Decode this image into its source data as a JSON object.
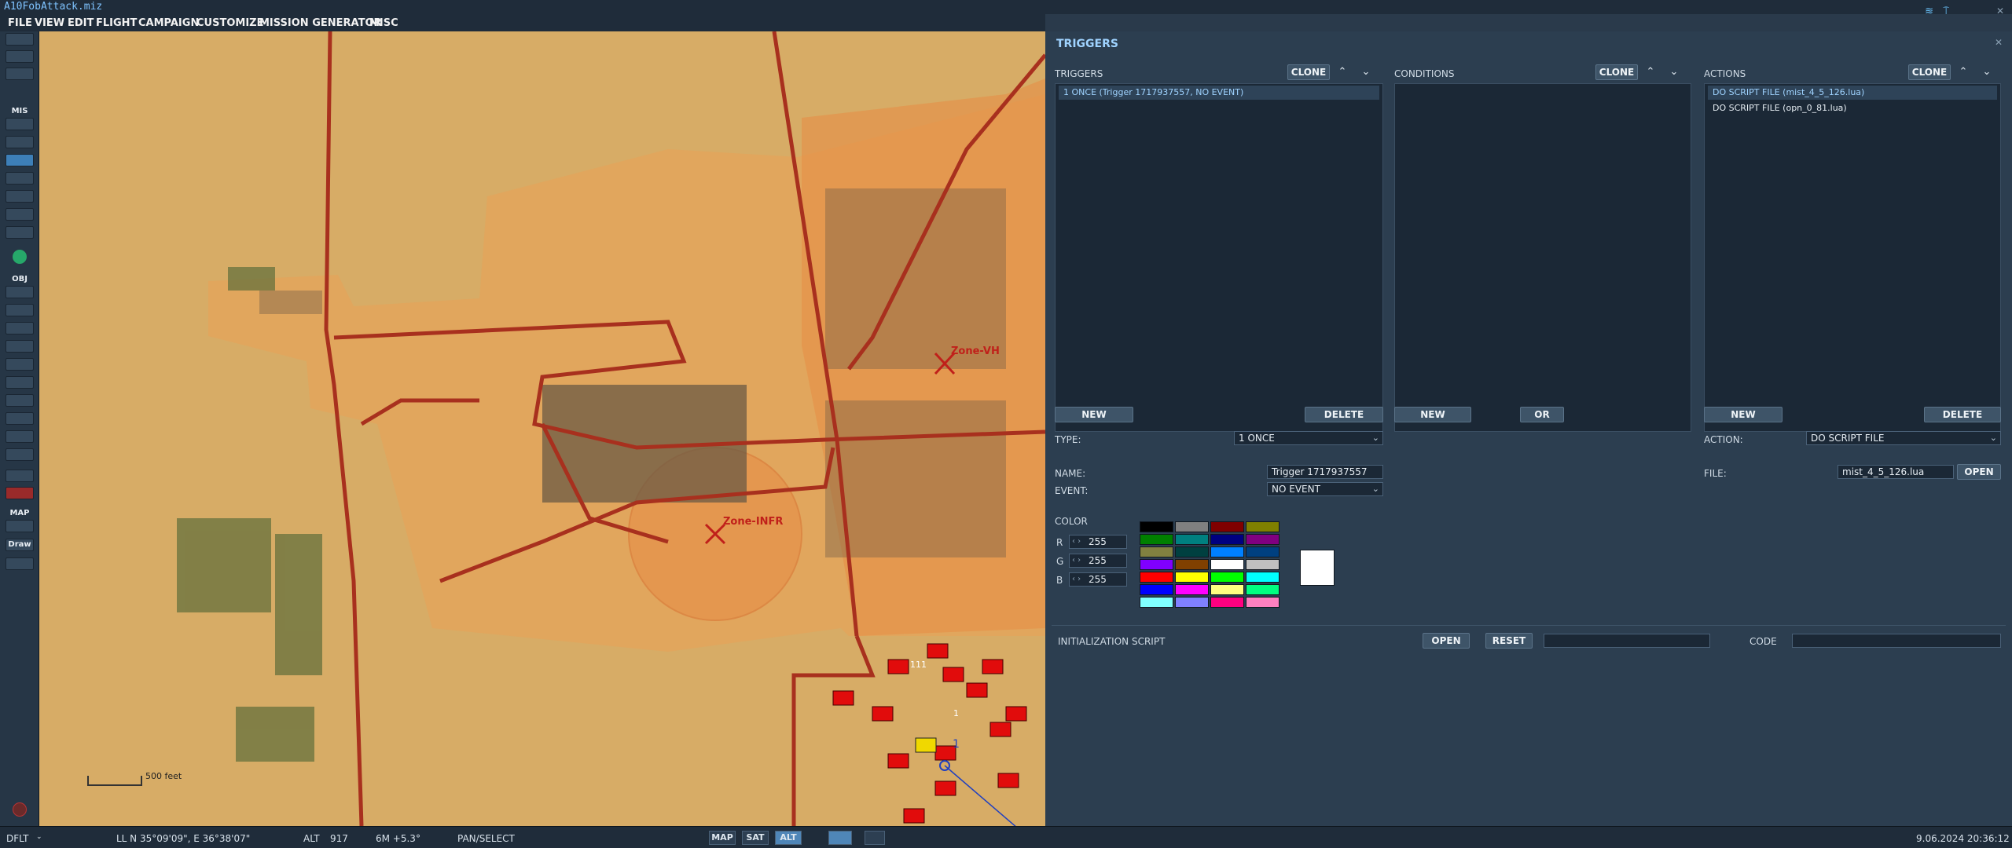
{
  "title": "A10FobAttack.miz",
  "menu": [
    "FILE",
    "VIEW",
    "EDIT",
    "FLIGHT",
    "CAMPAIGN",
    "CUSTOMIZE",
    "MISSION GENERATOR",
    "MISC"
  ],
  "toolbar": {
    "mis_label": "MIS",
    "obj_label": "OBJ",
    "map_label": "MAP",
    "draw_label": "Draw"
  },
  "map": {
    "zones": [
      "Zone-VH",
      "Zone-INFR"
    ],
    "scale_label": "500 feet",
    "unit_marks": [
      "1",
      "111",
      "1",
      "1",
      "1",
      "1",
      "1",
      "1",
      "1",
      "1",
      "1",
      "1"
    ]
  },
  "panel": {
    "title": "TRIGGERS",
    "triggers": {
      "label": "TRIGGERS",
      "clone": "CLONE",
      "items": [
        "1 ONCE (Trigger 1717937557, NO EVENT)"
      ],
      "new": "NEW",
      "delete": "DELETE"
    },
    "conditions": {
      "label": "CONDITIONS",
      "clone": "CLONE",
      "new": "NEW",
      "or": "OR"
    },
    "actions": {
      "label": "ACTIONS",
      "clone": "CLONE",
      "items": [
        "DO SCRIPT FILE (mist_4_5_126.lua)",
        "DO SCRIPT FILE (opn_0_81.lua)"
      ],
      "new": "NEW",
      "delete": "DELETE"
    },
    "type": {
      "label": "TYPE:",
      "value": "1 ONCE"
    },
    "name": {
      "label": "NAME:",
      "value": "Trigger 1717937557"
    },
    "event": {
      "label": "EVENT:",
      "value": "NO EVENT"
    },
    "action": {
      "label": "ACTION:",
      "value": "DO SCRIPT FILE"
    },
    "file": {
      "label": "FILE:",
      "value": "mist_4_5_126.lua",
      "open": "OPEN"
    },
    "color": {
      "label": "COLOR",
      "r_label": "R",
      "g_label": "G",
      "b_label": "B",
      "r": "255",
      "g": "255",
      "b": "255",
      "palette": [
        "#000000",
        "#808080",
        "#800000",
        "#808000",
        "#008000",
        "#008080",
        "#000080",
        "#800080",
        "#808040",
        "#004040",
        "#0080ff",
        "#004080",
        "#8000ff",
        "#804000",
        "#ffffff",
        "#c0c0c0",
        "#ff0000",
        "#ffff00",
        "#00ff00",
        "#00ffff",
        "#0000ff",
        "#ff00ff",
        "#ffff80",
        "#00ff80",
        "#80ffff",
        "#8080ff",
        "#ff0080",
        "#ff80c0"
      ],
      "preview": "#ffffff"
    },
    "init_script": {
      "label": "INITIALIZATION SCRIPT",
      "open": "OPEN",
      "reset": "RESET",
      "code_label": "CODE"
    }
  },
  "status": {
    "profile": "DFLT",
    "coords": "LL   N 35°09'09\", E 36°38'07\"",
    "alt_label": "ALT",
    "alt_value": "917",
    "mag": "6M  +5.3°",
    "mode": "PAN/SELECT",
    "btn_map": "MAP",
    "btn_sat": "SAT",
    "btn_alt": "ALT",
    "datetime": "9.06.2024 20:36:12"
  }
}
